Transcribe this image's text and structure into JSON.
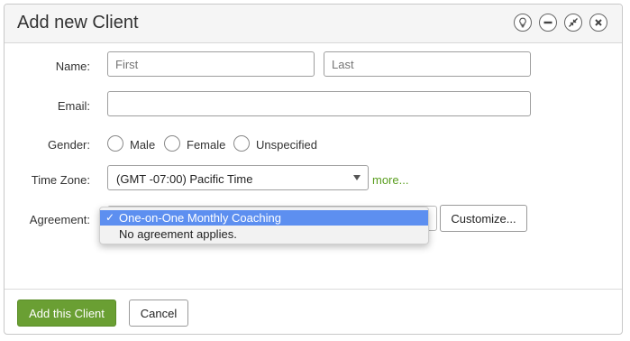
{
  "dialog": {
    "title": "Add new Client",
    "controls": [
      "lightbulb-icon",
      "minimize-icon",
      "collapse-icon",
      "close-icon"
    ]
  },
  "form": {
    "name": {
      "label": "Name:",
      "first_placeholder": "First",
      "last_placeholder": "Last"
    },
    "email": {
      "label": "Email:",
      "value": ""
    },
    "gender": {
      "label": "Gender:",
      "options": [
        "Male",
        "Female",
        "Unspecified"
      ]
    },
    "timezone": {
      "label": "Time Zone:",
      "value": "(GMT -07:00) Pacific Time",
      "more_link": "more..."
    },
    "agreement": {
      "label": "Agreement:",
      "options": [
        "One-on-One Monthly Coaching",
        "No agreement applies."
      ],
      "selected_index": 0,
      "customize_label": "Customize..."
    }
  },
  "footer": {
    "add_label": "Add this Client",
    "cancel_label": "Cancel"
  },
  "colors": {
    "accent_green": "#6a9f33",
    "link_green": "#5a9e1f",
    "selection_blue": "#5d8ff0"
  }
}
